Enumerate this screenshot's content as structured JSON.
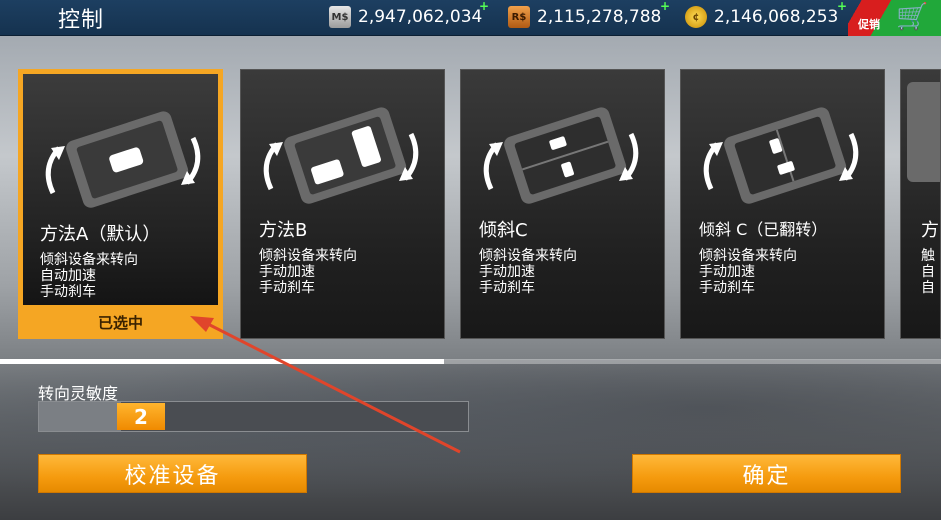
{
  "header": {
    "title": "控制",
    "currencies": [
      {
        "icon": "M$",
        "name": "ms-icon",
        "value": "2,947,062,034",
        "plus": "+"
      },
      {
        "icon": "R$",
        "name": "rs-icon",
        "value": "2,115,278,788",
        "plus": "+"
      },
      {
        "icon": "¢",
        "name": "coin-icon",
        "value": "2,146,068,253",
        "plus": "+"
      }
    ],
    "promo_label": "促销"
  },
  "cards": [
    {
      "title": "方法A（默认）",
      "lines": [
        "倾斜设备来转向",
        "自动加速",
        "手动刹车"
      ],
      "status": "已选中",
      "selected": true
    },
    {
      "title": "方法B",
      "lines": [
        "倾斜设备来转向",
        "手动加速",
        "手动刹车"
      ]
    },
    {
      "title": "倾斜C",
      "lines": [
        "倾斜设备来转向",
        "手动加速",
        "手动刹车"
      ]
    },
    {
      "title": "倾斜 C（已翻转）",
      "lines": [
        "倾斜设备来转向",
        "手动加速",
        "手动刹车"
      ]
    },
    {
      "title": "方",
      "lines": [
        "触",
        "自",
        "自"
      ]
    }
  ],
  "sensitivity": {
    "label": "转向灵敏度",
    "value": "2"
  },
  "buttons": {
    "calibrate": "校准设备",
    "confirm": "确定"
  },
  "colors": {
    "accent": "#f5a623",
    "topbar": "#1d3f61",
    "annotation_arrow": "#e0452b"
  }
}
